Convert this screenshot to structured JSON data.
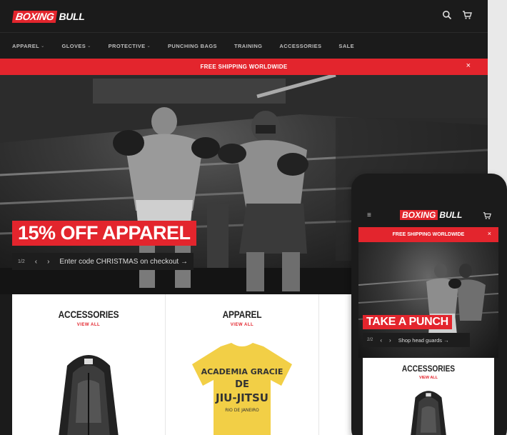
{
  "brand": {
    "part1": "BOXING",
    "part2": "BULL"
  },
  "nav": {
    "items": [
      {
        "label": "APPAREL",
        "dropdown": true
      },
      {
        "label": "GLOVES",
        "dropdown": true
      },
      {
        "label": "PROTECTIVE",
        "dropdown": true
      },
      {
        "label": "PUNCHING BAGS",
        "dropdown": false
      },
      {
        "label": "TRAINING",
        "dropdown": false
      },
      {
        "label": "ACCESSORIES",
        "dropdown": false
      },
      {
        "label": "SALE",
        "dropdown": false
      }
    ]
  },
  "promo": {
    "text": "FREE SHIPPING WORLDWIDE",
    "close": "×"
  },
  "hero": {
    "headline": "15% OFF APPAREL",
    "pager": "1/2",
    "prev": "‹",
    "next": "›",
    "cta": "Enter code CHRISTMAS on checkout →"
  },
  "collections": [
    {
      "title": "ACCESSORIES",
      "link": "VIEW ALL"
    },
    {
      "title": "APPAREL",
      "link": "VIEW ALL"
    }
  ],
  "shirt_print": {
    "line1": "ACADEMIA GRACIE",
    "line2": "DE",
    "line3": "JIU-JITSU",
    "line4": "RIO DE JANEIRO"
  },
  "mobile": {
    "menu_icon": "≡",
    "promo": {
      "text": "FREE SHIPPING WORLDWIDE",
      "close": "×"
    },
    "hero": {
      "headline": "TAKE A PUNCH",
      "pager": "2/2",
      "prev": "‹",
      "next": "›",
      "cta": "Shop head guards →"
    },
    "card": {
      "title": "ACCESSORIES",
      "link": "VIEW ALL"
    }
  },
  "colors": {
    "accent": "#e3252d",
    "dark": "#1b1b1b",
    "shirt": "#f2cf46"
  },
  "icons": [
    "search-icon",
    "cart-icon",
    "close-icon",
    "menu-icon",
    "chevron-down-icon"
  ]
}
